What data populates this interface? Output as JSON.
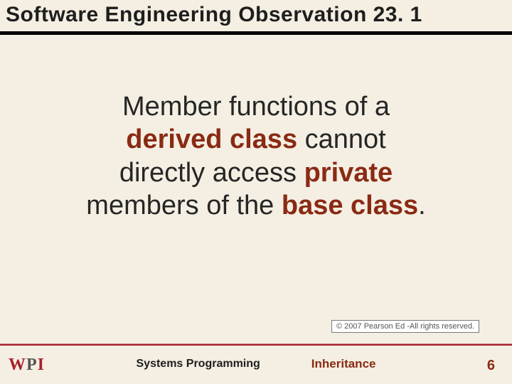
{
  "title": "Software Engineering Observation 23. 1",
  "body": {
    "line1_pre": "Member functions of a",
    "kw_derived": "derived class",
    "line2_mid": " cannot",
    "line3_pre": "directly access ",
    "kw_private": "private",
    "line4_pre": "members of the ",
    "kw_base": "base class",
    "tail": "."
  },
  "copyright": "© 2007 Pearson Ed -All rights reserved.",
  "footer": {
    "left_label": "Systems Programming",
    "center_label": "Inheritance",
    "page": "6"
  },
  "logo": {
    "w": "W",
    "p": "P",
    "i": "I"
  }
}
